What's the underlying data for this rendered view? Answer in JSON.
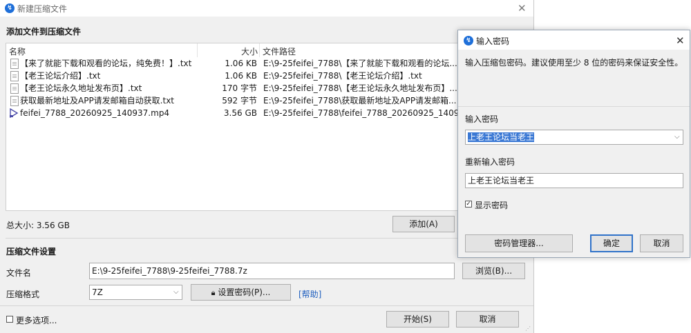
{
  "window": {
    "title": "新建压缩文件",
    "add_section_title": "添加文件到压缩文件",
    "columns": {
      "name": "名称",
      "size": "大小",
      "path": "文件路径"
    },
    "files": [
      {
        "icon": "text-file-icon",
        "name": "【来了就能下载和观看的论坛，纯免费！】.txt",
        "size": "1.06 KB",
        "path": "E:\\9-25feifei_7788\\【来了就能下载和观看的论坛..."
      },
      {
        "icon": "text-file-icon",
        "name": "【老王论坛介绍】.txt",
        "size": "1.06 KB",
        "path": "E:\\9-25feifei_7788\\【老王论坛介绍】.txt"
      },
      {
        "icon": "text-file-icon",
        "name": "【老王论坛永久地址发布页】.txt",
        "size": "170 字节",
        "path": "E:\\9-25feifei_7788\\【老王论坛永久地址发布页】...."
      },
      {
        "icon": "text-file-icon",
        "name": "获取最新地址及APP请发邮箱自动获取.txt",
        "size": "592 字节",
        "path": "E:\\9-25feifei_7788\\获取最新地址及APP请发邮箱..."
      },
      {
        "icon": "video-file-icon",
        "name": "feifei_7788_20260925_140937.mp4",
        "size": "3.56 GB",
        "path": "E:\\9-25feifei_7788\\feifei_7788_20260925_1409..."
      }
    ],
    "total_size": "总大小: 3.56 GB",
    "add_button": "添加(A)",
    "settings_title": "压缩文件设置",
    "filename_label": "文件名",
    "filename_value": "E:\\9-25feifei_7788\\9-25feifei_7788.7z",
    "browse_button": "浏览(B)...",
    "format_label": "压缩格式",
    "format_value": "7Z",
    "set_password_button": "设置密码(P)...",
    "help_link": "[帮助]",
    "more_options": "更多选项...",
    "start_button": "开始(S)",
    "cancel_button": "取消"
  },
  "dialog": {
    "title": "输入密码",
    "description": "输入压缩包密码。建议使用至少 8 位的密码来保证安全性。",
    "password_label": "输入密码",
    "password_value": "上老王论坛当老王",
    "confirm_label": "重新输入密码",
    "confirm_value": "上老王论坛当老王",
    "show_password_label": "显示密码",
    "show_password_checked": true,
    "manager_button": "密码管理器...",
    "ok_button": "确定",
    "cancel_button": "取消"
  }
}
